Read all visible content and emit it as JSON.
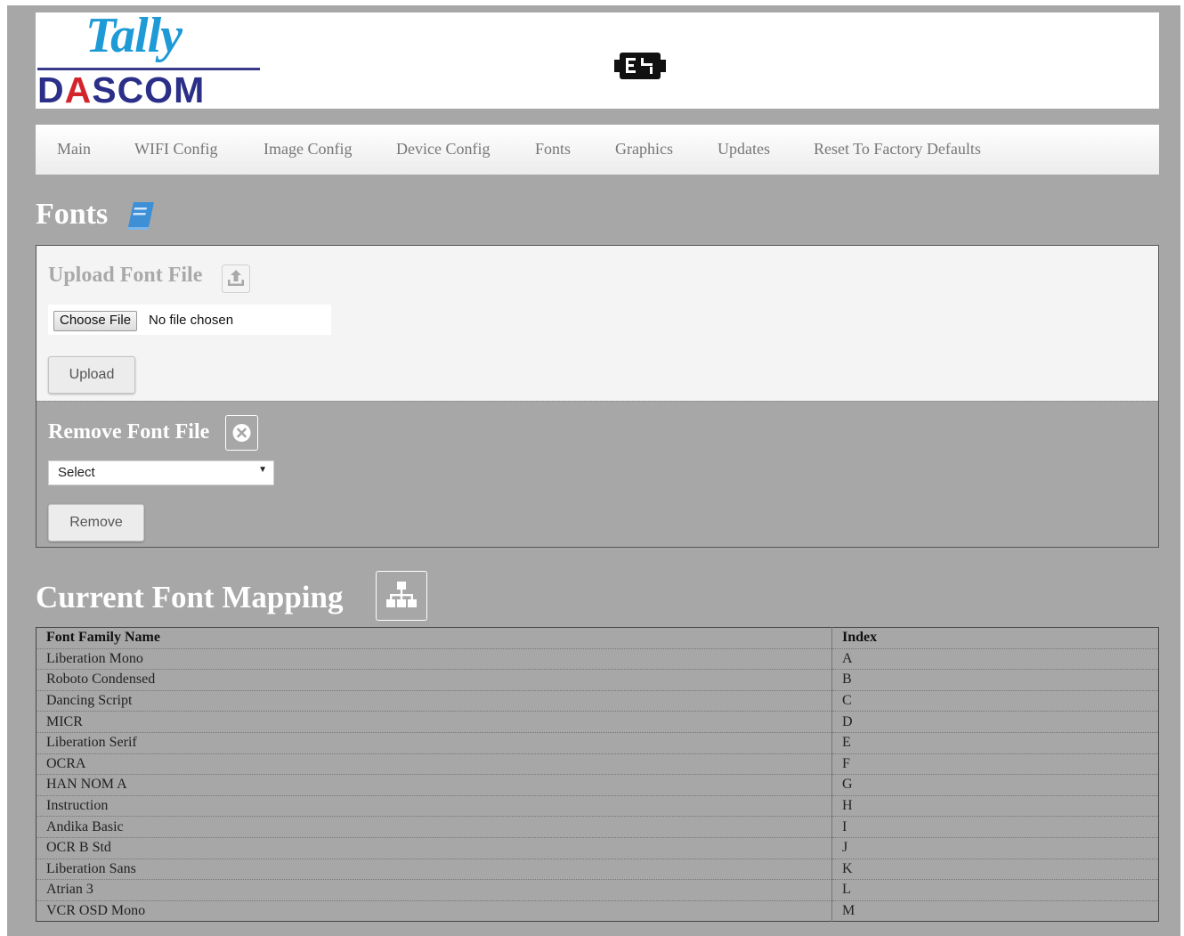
{
  "header": {
    "logo_top": "Tally",
    "logo_bottom_parts": [
      "D",
      "A",
      "SCOM"
    ],
    "printer_icon": "printer-connector-icon"
  },
  "nav": {
    "items": [
      "Main",
      "WIFI Config",
      "Image Config",
      "Device Config",
      "Fonts",
      "Graphics",
      "Updates",
      "Reset To Factory Defaults"
    ]
  },
  "page": {
    "title": "Fonts",
    "title_icon": "book-icon"
  },
  "upload": {
    "title": "Upload Font File",
    "icon": "upload-icon",
    "choose_label": "Choose File",
    "file_status": "No file chosen",
    "button_label": "Upload"
  },
  "remove": {
    "title": "Remove Font File",
    "icon": "remove-circle-icon",
    "select_value": "Select",
    "button_label": "Remove"
  },
  "mapping": {
    "title": "Current Font Mapping",
    "icon": "sitemap-icon",
    "headers": [
      "Font Family Name",
      "Index"
    ],
    "rows": [
      [
        "Liberation Mono",
        "A"
      ],
      [
        "Roboto Condensed",
        "B"
      ],
      [
        "Dancing Script",
        "C"
      ],
      [
        "MICR",
        "D"
      ],
      [
        "Liberation Serif",
        "E"
      ],
      [
        "OCRA",
        "F"
      ],
      [
        "HAN NOM A",
        "G"
      ],
      [
        "Instruction",
        "H"
      ],
      [
        "Andika Basic",
        "I"
      ],
      [
        "OCR B Std",
        "J"
      ],
      [
        "Liberation Sans",
        "K"
      ],
      [
        "Atrian 3",
        "L"
      ],
      [
        "VCR OSD Mono",
        "M"
      ]
    ]
  },
  "colors": {
    "background": "#a7a7a7",
    "logo_blue": "#1e9ad6",
    "logo_navy": "#2b2f88",
    "logo_red": "#d3242c"
  }
}
